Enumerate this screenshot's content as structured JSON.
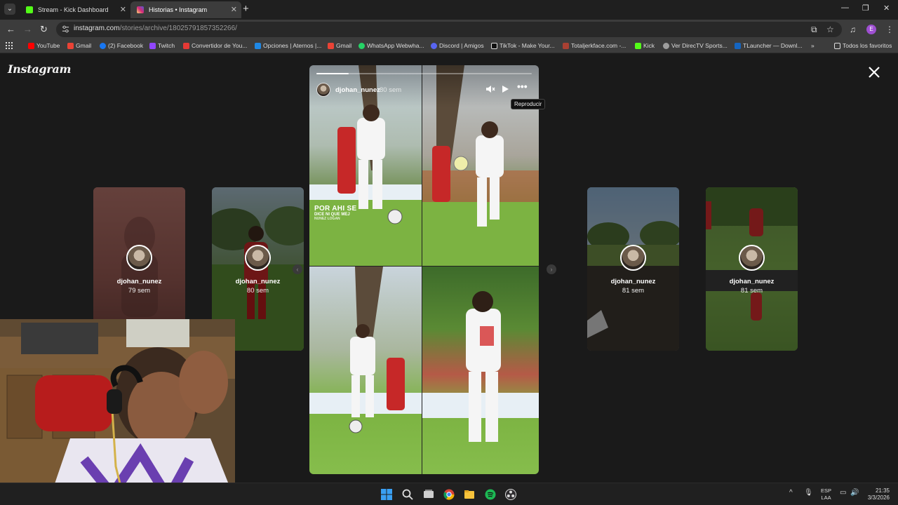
{
  "browser": {
    "tabs": [
      {
        "title": "Stream - Kick Dashboard",
        "active": false,
        "favicon_color": "#53fc18"
      },
      {
        "title": "Historias • Instagram",
        "active": true,
        "favicon_color": "#d62976"
      }
    ],
    "url_host": "instagram.com",
    "url_path": "/stories/archive/18025791857352266/",
    "bookmarks": [
      {
        "label": "YouTube",
        "color": "#ff0000"
      },
      {
        "label": "Gmail",
        "color": "#ea4335"
      },
      {
        "label": "(2) Facebook",
        "color": "#1877f2"
      },
      {
        "label": "Twitch",
        "color": "#9146ff"
      },
      {
        "label": "Convertidor de You...",
        "color": "#e53935"
      },
      {
        "label": "Opciones | Aternos |...",
        "color": "#1e88e5"
      },
      {
        "label": "Gmail",
        "color": "#ea4335"
      },
      {
        "label": "WhatsApp Webwha...",
        "color": "#25d366"
      },
      {
        "label": "Discord | Amigos",
        "color": "#5865f2"
      },
      {
        "label": "TikTok - Make Your...",
        "color": "#111111"
      },
      {
        "label": "Totaljerkface.com -...",
        "color": "#a84032"
      },
      {
        "label": "Kick",
        "color": "#53fc18"
      },
      {
        "label": "Ver DirecTV Sports...",
        "color": "#9e9e9e"
      },
      {
        "label": "TLauncher — Downl...",
        "color": "#1565c0"
      }
    ],
    "all_bookmarks": "Todos los favoritos",
    "profile_letter": "E"
  },
  "instagram": {
    "logo": "Instagram",
    "main_story": {
      "username": "djohan_nunez",
      "time": "80 sem",
      "progress": 0.15,
      "tooltip": "Reproducir",
      "caption_line1": "POR AHI SE",
      "caption_line2": "DICE NI QUE MEJ",
      "caption_line3": "NUNEZ LOGAN"
    },
    "side_stories": [
      {
        "username": "djohan_nunez",
        "time": "79 sem"
      },
      {
        "username": "djohan_nunez",
        "time": "80 sem"
      },
      {
        "username": "djohan_nunez",
        "time": "81 sem"
      },
      {
        "username": "djohan_nunez",
        "time": "81 sem"
      }
    ]
  },
  "taskbar": {
    "lang_line1": "ESP",
    "lang_line2": "LAA",
    "time": "21:35",
    "date": "3/3/2026"
  }
}
